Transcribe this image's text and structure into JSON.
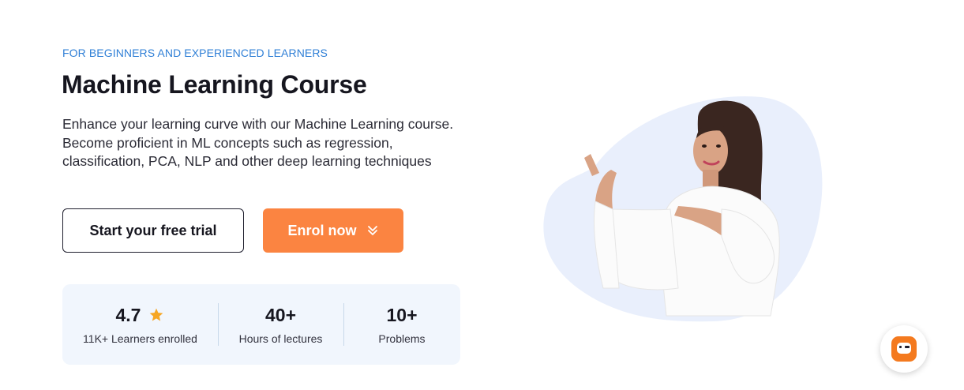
{
  "hero": {
    "eyebrow": "FOR BEGINNERS AND EXPERIENCED LEARNERS",
    "title": "Machine Learning Course",
    "description_lines": [
      "Enhance your learning curve with our Machine Learning course.",
      "Become proficient in ML concepts such as regression,",
      "classification, PCA, NLP and other deep learning techniques"
    ]
  },
  "buttons": {
    "trial_label": "Start your free trial",
    "enrol_label": "Enrol now"
  },
  "stats": [
    {
      "value": "4.7",
      "label": "11K+ Learners enrolled",
      "icon": "star-icon"
    },
    {
      "value": "40+",
      "label": "Hours of lectures"
    },
    {
      "value": "10+",
      "label": "Problems"
    }
  ],
  "colors": {
    "accent": "#fb8441",
    "eyebrow": "#2f7fd6",
    "stats_bg": "#f1f6fd",
    "blob": "#e9effc",
    "star": "#f6a623"
  },
  "images": {
    "hero": "woman-pointing-illustration",
    "chat": "chat-widget-icon"
  }
}
